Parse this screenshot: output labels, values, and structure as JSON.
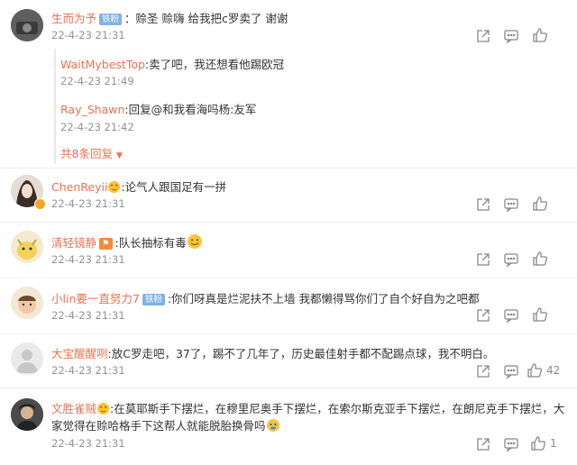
{
  "comments": [
    {
      "user": "生而为予",
      "badge": "铁粉",
      "text": "：赊圣 赊嗨 给我把c罗卖了 谢谢",
      "time": "22-4-23 21:31",
      "likes": "",
      "replies": [
        {
          "user": "WaitMybestTop",
          "text": ":卖了吧，我还想看他踢欧冠",
          "time": "22-4-23 21:49"
        },
        {
          "user": "Ray_Shawn",
          "text": ":回复@和我看海吗杨:友军",
          "time": "22-4-23 21:42"
        }
      ],
      "more_replies": "共8条回复"
    },
    {
      "user": "ChenReyii",
      "badge": "",
      "text": ":论气人跟国足有一拼",
      "time": "22-4-23 21:31",
      "likes": ""
    },
    {
      "user": "清轻镜静",
      "badge": "",
      "text": ":队长抽标有毒",
      "time": "22-4-23 21:31",
      "likes": ""
    },
    {
      "user": "小lin要一直努力7",
      "badge": "铁粉",
      "text": ":你们呀真是烂泥扶不上墙 我都懒得骂你们了自个好自为之吧都",
      "time": "22-4-23 21:31",
      "likes": ""
    },
    {
      "user": "大宝醒醒咧",
      "badge": "",
      "text": ":放C罗走吧，37了，踢不了几年了，历史最佳射手都不配踢点球，我不明白。",
      "time": "22-4-23 21:31",
      "likes": "42"
    },
    {
      "user": "文胜雀贼",
      "badge": "",
      "text": ":在莫耶斯手下摆烂，在穆里尼奥手下摆烂，在索尔斯克亚手下摆烂，在朗尼克手下摆烂，大",
      "text2": "家觉得在赊哈格手下这帮人就能脱胎换骨吗",
      "time": "22-4-23 21:31",
      "likes": "1"
    }
  ],
  "icons": {
    "share": "share-icon",
    "comment": "comment-icon",
    "like": "thumbs-up-icon"
  },
  "colors": {
    "username": "#eb7350",
    "time": "#939393",
    "badge": "#7fb1e6"
  }
}
